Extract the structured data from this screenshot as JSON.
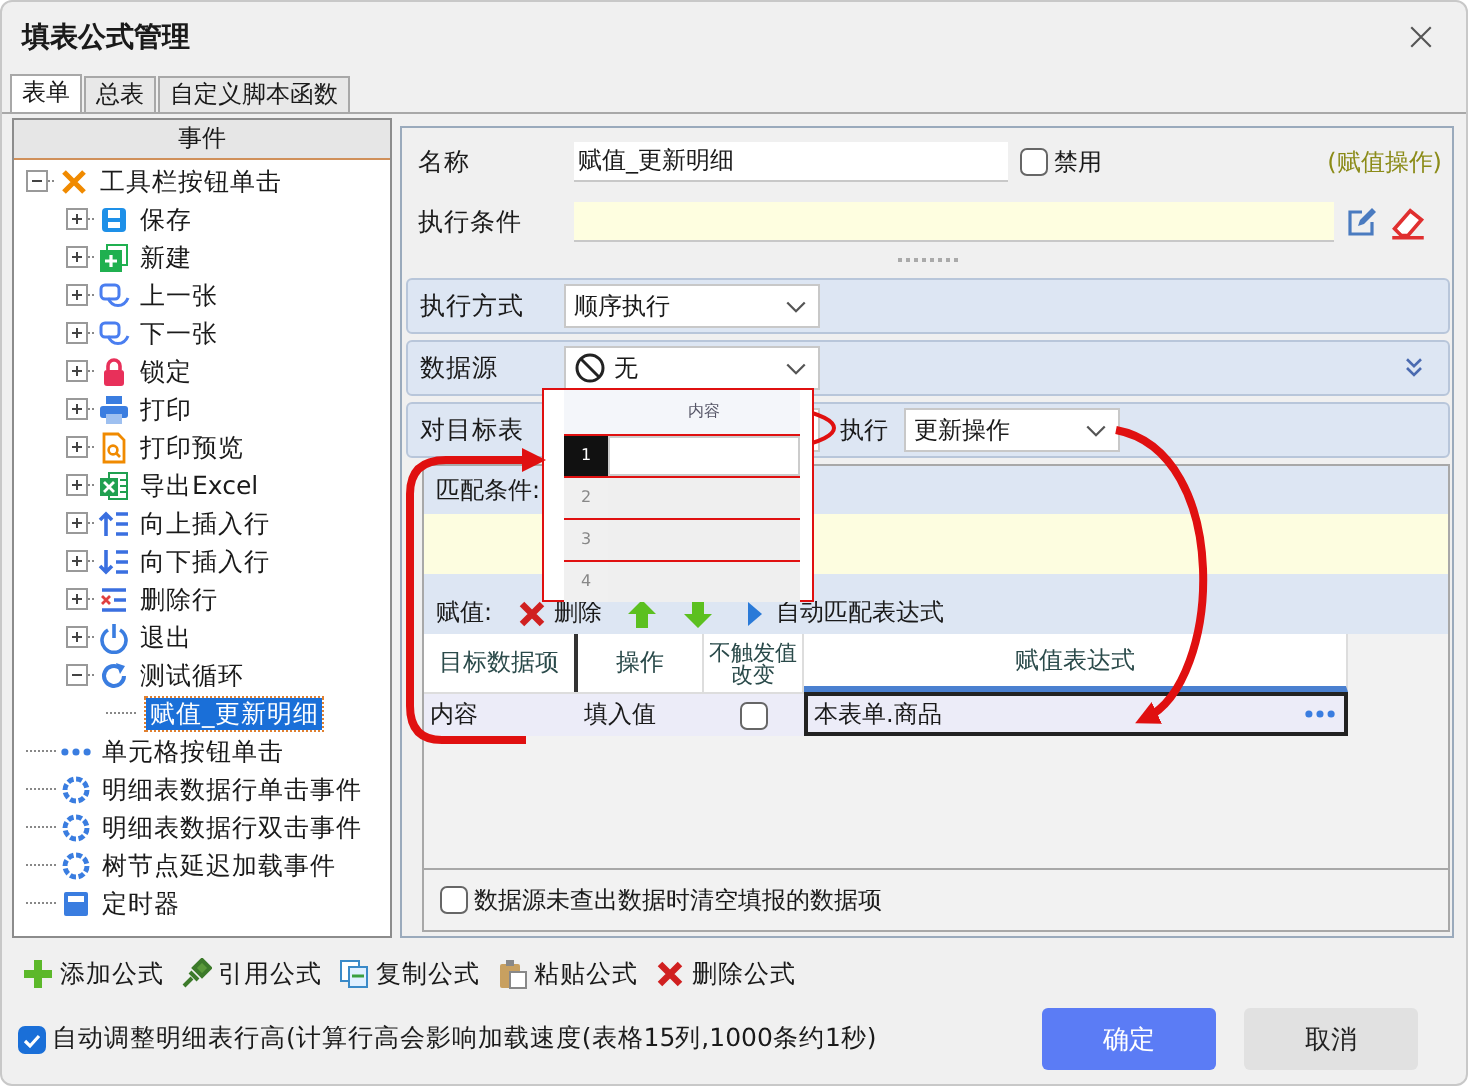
{
  "window": {
    "title": "填表公式管理"
  },
  "tabs": [
    {
      "label": "表单",
      "selected": true
    },
    {
      "label": "总表",
      "selected": false
    },
    {
      "label": "自定义脚本函数",
      "selected": false
    }
  ],
  "event_tree": {
    "header": "事件",
    "items": [
      {
        "label": "工具栏按钮单击",
        "kind": "tools",
        "expanded": true,
        "selected": false,
        "children": [
          {
            "label": "保存",
            "kind": "save",
            "expanded": false,
            "selected": false
          },
          {
            "label": "新建",
            "kind": "new",
            "expanded": false,
            "selected": false
          },
          {
            "label": "上一张",
            "kind": "prev",
            "expanded": false,
            "selected": false
          },
          {
            "label": "下一张",
            "kind": "next",
            "expanded": false,
            "selected": false
          },
          {
            "label": "锁定",
            "kind": "lock",
            "expanded": false,
            "selected": false
          },
          {
            "label": "打印",
            "kind": "print",
            "expanded": false,
            "selected": false
          },
          {
            "label": "打印预览",
            "kind": "preview",
            "expanded": false,
            "selected": false
          },
          {
            "label": "导出Excel",
            "kind": "excel",
            "expanded": false,
            "selected": false
          },
          {
            "label": "向上插入行",
            "kind": "insert_up",
            "expanded": false,
            "selected": false
          },
          {
            "label": "向下插入行",
            "kind": "insert_down",
            "expanded": false,
            "selected": false
          },
          {
            "label": "删除行",
            "kind": "delete_row",
            "expanded": false,
            "selected": false
          },
          {
            "label": "退出",
            "kind": "exit",
            "expanded": false,
            "selected": false
          },
          {
            "label": "测试循环",
            "kind": "loop",
            "expanded": true,
            "selected": false,
            "children": [
              {
                "label": "赋值_更新明细",
                "selected": true
              }
            ]
          }
        ]
      },
      {
        "label": "单元格按钮单击",
        "kind": "dots",
        "selected": false
      },
      {
        "label": "明细表数据行单击事件",
        "kind": "ring",
        "selected": false
      },
      {
        "label": "明细表数据行双击事件",
        "kind": "ring",
        "selected": false
      },
      {
        "label": "树节点延迟加载事件",
        "kind": "ring",
        "selected": false
      },
      {
        "label": "定时器",
        "kind": "timer",
        "selected": false
      }
    ]
  },
  "form": {
    "name_label": "名称",
    "name_value": "赋值_更新明细",
    "disable": {
      "label": "禁用",
      "checked": false
    },
    "operation_type": "(赋值操作)",
    "condition_label": "执行条件",
    "sections": [
      {
        "kind": "mode",
        "label": "执行方式",
        "value": "顺序执行"
      },
      {
        "kind": "source",
        "label": "数据源",
        "value": "无"
      },
      {
        "kind": "target",
        "label": "对目标表",
        "execute_label": "执行",
        "execute_value": "更新操作"
      }
    ],
    "match_label": "匹配条件:",
    "assign": {
      "label": "赋值:",
      "items": [
        {
          "kind": "delete",
          "label": "删除"
        },
        {
          "kind": "up"
        },
        {
          "kind": "down"
        },
        {
          "kind": "auto",
          "label": "自动匹配表达式"
        }
      ]
    },
    "grid": {
      "columns": [
        "目标数据项",
        "操作",
        "不触发值改变",
        "赋值表达式"
      ],
      "rows": [
        {
          "target": "内容",
          "operation": "填入值",
          "no_trigger": false,
          "expression": "本表单.商品"
        }
      ]
    },
    "clear_option": {
      "label": "数据源未查出数据时清空填报的数据项",
      "checked": false
    }
  },
  "dropdown": {
    "header": "内容",
    "rows": [
      {
        "number": "1",
        "selected": true
      },
      {
        "number": "2",
        "selected": false
      },
      {
        "number": "3",
        "selected": false
      },
      {
        "number": "4",
        "selected": false
      }
    ]
  },
  "toolbar": [
    {
      "kind": "add",
      "label": "添加公式"
    },
    {
      "kind": "plug",
      "label": "引用公式"
    },
    {
      "kind": "copy",
      "label": "复制公式"
    },
    {
      "kind": "paste",
      "label": "粘贴公式"
    },
    {
      "kind": "remove",
      "label": "删除公式"
    }
  ],
  "auto_height": {
    "label": "自动调整明细表行高(计算行高会影响加载速度(表格15列,1000条约1秒)",
    "checked": true
  },
  "buttons": [
    {
      "label": "确定",
      "primary": true
    },
    {
      "label": "取消",
      "primary": false
    }
  ]
}
